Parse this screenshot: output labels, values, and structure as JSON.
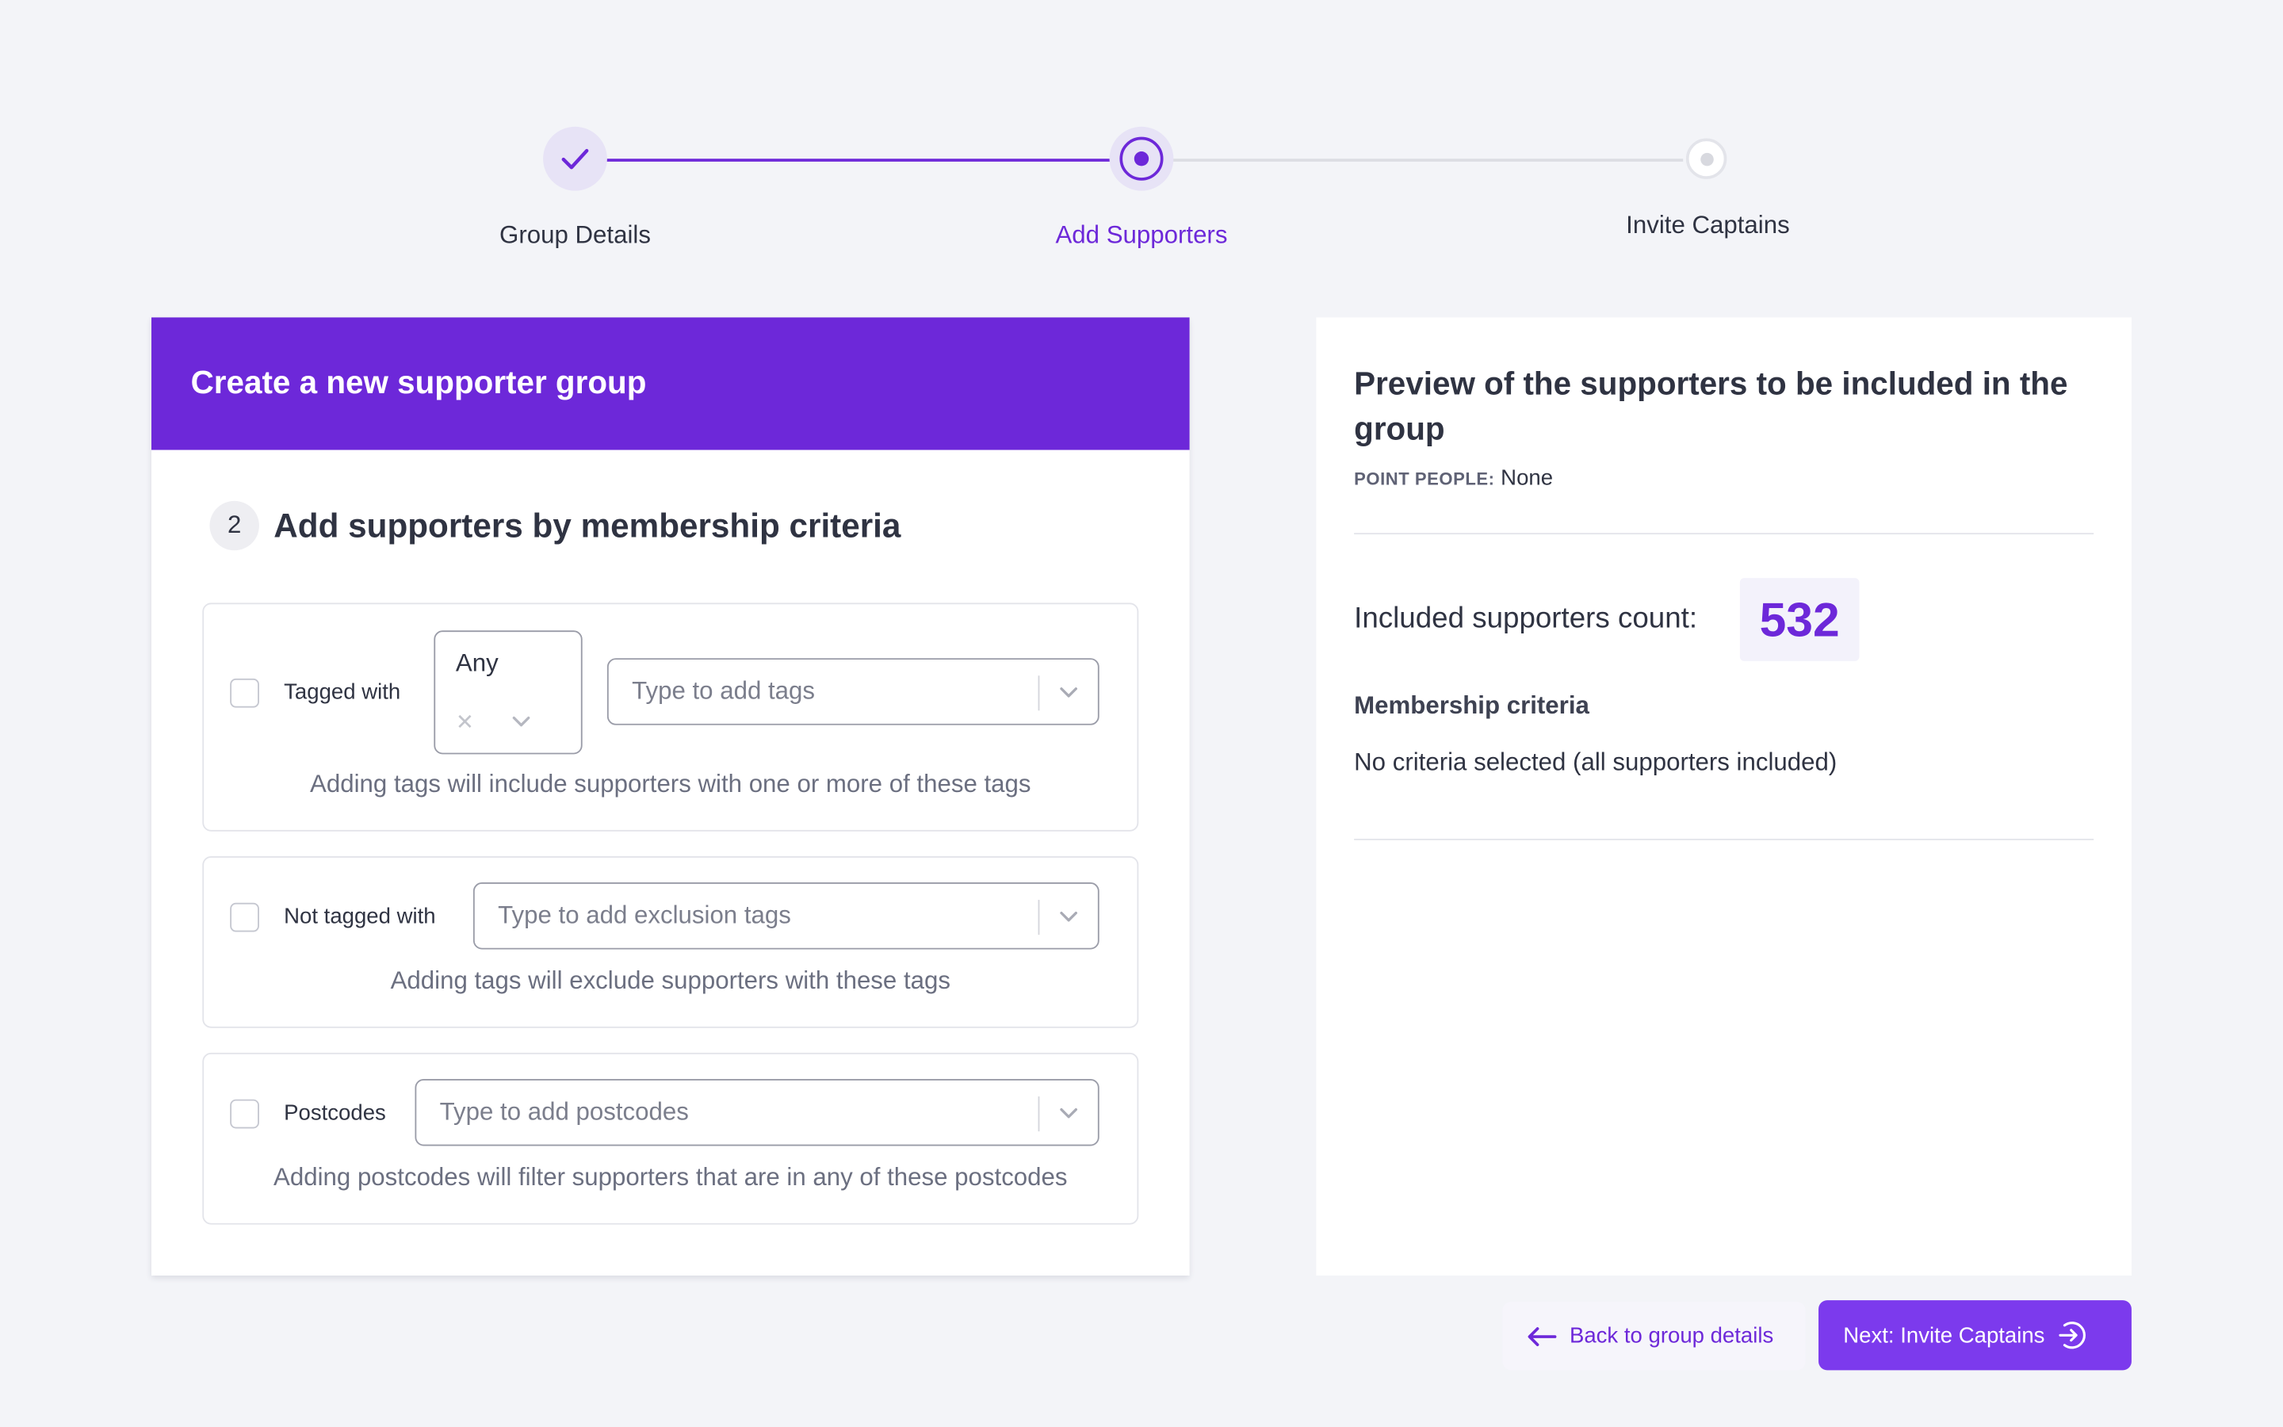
{
  "stepper": {
    "steps": [
      {
        "label": "Group Details",
        "state": "completed"
      },
      {
        "label": "Add Supporters",
        "state": "current"
      },
      {
        "label": "Invite Captains",
        "state": "upcoming"
      }
    ]
  },
  "form": {
    "header_title": "Create a new supporter group",
    "section_number": "2",
    "section_title": "Add supporters by membership criteria",
    "criteria": {
      "tagged": {
        "label": "Tagged with",
        "match_value": "Any",
        "placeholder": "Type to add tags",
        "hint": "Adding tags will include supporters with one or more of these tags"
      },
      "not_tagged": {
        "label": "Not tagged with",
        "placeholder": "Type to add exclusion tags",
        "hint": "Adding tags will exclude supporters with these tags"
      },
      "postcodes": {
        "label": "Postcodes",
        "placeholder": "Type to add postcodes",
        "hint": "Adding postcodes will filter supporters that are in any of these postcodes"
      }
    }
  },
  "preview": {
    "title": "Preview of the supporters to be included in the group",
    "point_people_label": "POINT PEOPLE:",
    "point_people_value": "None",
    "count_label": "Included supporters count:",
    "count_value": "532",
    "criteria_title": "Membership criteria",
    "criteria_text": "No criteria selected (all supporters included)"
  },
  "actions": {
    "back_label": "Back to group details",
    "next_label": "Next: Invite Captains"
  },
  "colors": {
    "accent": "#6d28d9",
    "button": "#7c3aed",
    "background": "#f3f4f8"
  },
  "icons": {
    "step_done": "check-icon",
    "back": "arrow-left-icon",
    "next": "arrow-right-circle-icon",
    "select": "chevron-down-icon",
    "clear": "close-icon"
  }
}
